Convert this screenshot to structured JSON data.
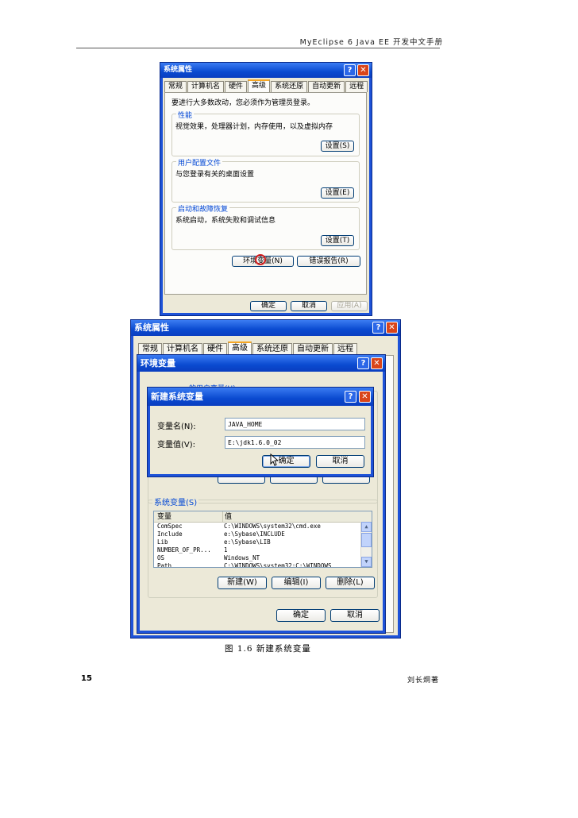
{
  "header": {
    "title": "MyEclipse 6 Java EE 开发中文手册"
  },
  "fig1": {
    "title": "系统属性",
    "tabs": [
      "常规",
      "计算机名",
      "硬件",
      "高级",
      "系统还原",
      "自动更新",
      "远程"
    ],
    "notice": "要进行大多数改动，您必须作为管理员登录。",
    "perf_label": "性能",
    "perf_desc": "视觉效果，处理器计划，内存使用，以及虚拟内存",
    "profile_label": "用户配置文件",
    "profile_desc": "与您登录有关的桌面设置",
    "startup_label": "启动和故障恢复",
    "startup_desc": "系统启动，系统失败和调试信息",
    "settings_s": "设置(S)",
    "settings_e": "设置(E)",
    "settings_t": "设置(T)",
    "env_button": "环境变量(N)",
    "error_button": "错误报告(R)",
    "ok": "确定",
    "cancel": "取消",
    "apply": "应用(A)"
  },
  "fig2": {
    "sys_title": "系统属性",
    "tabs": [
      "常规",
      "计算机名",
      "硬件",
      "高级",
      "系统还原",
      "自动更新",
      "远程"
    ],
    "env_title": "环境变量",
    "user_vars_partial": "的用户变量(U)",
    "new_title": "新建系统变量",
    "name_label": "变量名(N):",
    "value_label": "变量值(V):",
    "name_value": "JAVA_HOME",
    "value_value": "E:\\jdk1.6.0_02",
    "ok": "确定",
    "cancel": "取消",
    "sys_vars_label": "系统变量(S)",
    "col_var": "变量",
    "col_val": "值",
    "rows": [
      [
        "ComSpec",
        "C:\\WINDOWS\\system32\\cmd.exe"
      ],
      [
        "Include",
        "e:\\Sybase\\INCLUDE"
      ],
      [
        "Lib",
        "e:\\Sybase\\LIB"
      ],
      [
        "NUMBER_OF_PR...",
        "1"
      ],
      [
        "OS",
        "Windows_NT"
      ],
      [
        "Path",
        "C:\\WINDOWS\\system32;C:\\WINDOWS"
      ]
    ],
    "new_btn": "新建(W)",
    "edit_btn": "编辑(I)",
    "delete_btn": "删除(L)",
    "env_ok": "确定",
    "env_cancel": "取消"
  },
  "caption": "图 1.6  新建系统变量",
  "page_number": "15",
  "author": "刘长炯著"
}
